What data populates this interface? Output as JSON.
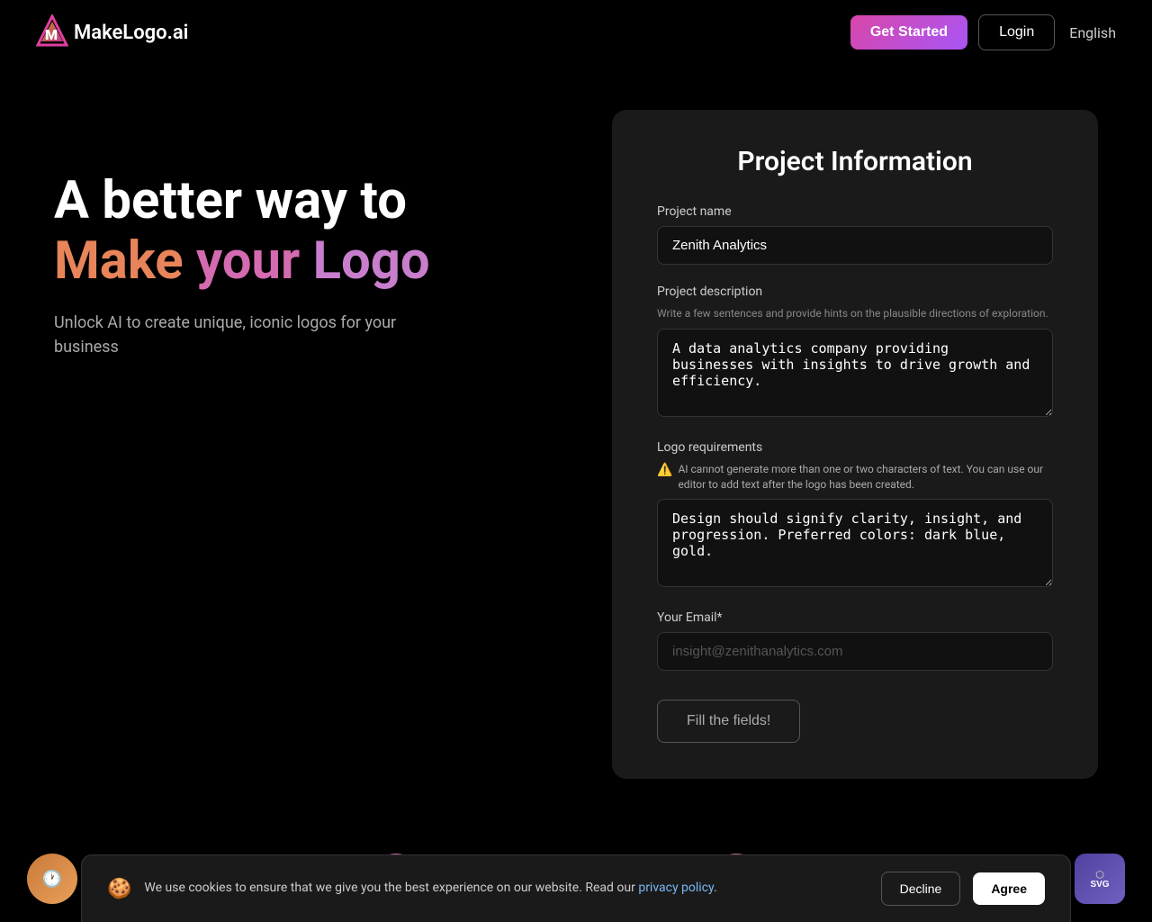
{
  "header": {
    "logo_text": "akeLogo.ai",
    "logo_letter": "M",
    "get_started_label": "Get Started",
    "login_label": "Login",
    "language_label": "English"
  },
  "hero": {
    "tagline_line1": "A better way to",
    "tagline_word1": "Make",
    "tagline_word2": "your",
    "tagline_word3": "Logo",
    "subtitle": "Unlock AI to create unique, iconic logos for your business"
  },
  "form": {
    "title": "Project Information",
    "project_name_label": "Project name",
    "project_name_value": "Zenith Analytics",
    "project_description_label": "Project description",
    "project_description_sublabel": "Write a few sentences and provide hints on the plausible directions of exploration.",
    "project_description_value": "A data analytics company providing businesses with insights to drive growth and efficiency.",
    "logo_requirements_label": "Logo requirements",
    "logo_requirements_warning": "AI cannot generate more than one or two characters of text. You can use our editor to add text after the logo has been created.",
    "logo_requirements_value": "Design should signify clarity, insight, and progression. Preferred colors: dark blue, gold.",
    "email_label": "Your Email*",
    "email_placeholder": "insight@zenithanalytics.com",
    "submit_label": "Fill the fields!"
  },
  "cookie": {
    "text": "We use cookies to ensure that we give you the best experience on our website. Read our",
    "link_text": "privacy policy",
    "decline_label": "Decline",
    "agree_label": "Agree"
  },
  "bottom_buttons": {
    "history_icon": "🕐",
    "svg_label": "SVG"
  }
}
